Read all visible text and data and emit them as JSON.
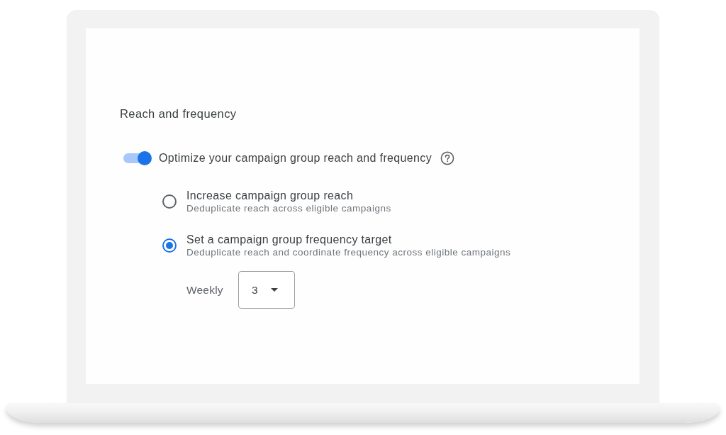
{
  "section": {
    "title": "Reach and frequency"
  },
  "toggle": {
    "label": "Optimize your campaign group reach and frequency",
    "on": true
  },
  "options": [
    {
      "title": "Increase campaign group reach",
      "description": "Deduplicate reach across eligible campaigns",
      "selected": false
    },
    {
      "title": "Set a campaign group frequency target",
      "description": "Deduplicate reach and coordinate frequency across eligible campaigns",
      "selected": true
    }
  ],
  "frequency": {
    "label": "Weekly",
    "value": "3"
  }
}
